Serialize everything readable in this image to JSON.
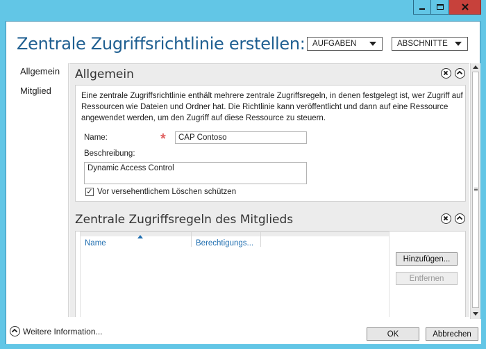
{
  "window": {
    "controls": {
      "minimize_icon": "minimize-icon",
      "maximize_icon": "maximize-icon",
      "close_icon": "close-icon"
    }
  },
  "header": {
    "title": "Zentrale Zugriffsrichtlinie erstellen: CAP...",
    "tasks_label": "AUFGABEN",
    "sections_label": "ABSCHNITTE"
  },
  "nav": {
    "items": [
      {
        "label": "Allgemein"
      },
      {
        "label": "Mitglied"
      }
    ]
  },
  "general": {
    "title": "Allgemein",
    "description": "Eine zentrale Zugriffsrichtlinie enthält mehrere zentrale Zugriffsregeln, in denen festgelegt ist, wer Zugriff auf Ressourcen wie Dateien und Ordner hat. Die Richtlinie kann veröffentlicht und dann auf eine Ressource angewendet werden, um den Zugriff auf diese Ressource zu steuern.",
    "name_label": "Name:",
    "name_value": "CAP Contoso",
    "required_marker": "*",
    "description_label": "Beschreibung:",
    "description_value": "Dynamic Access Control",
    "protect_label": "Vor versehentlichem Löschen schützen",
    "protect_checked": true,
    "check_glyph": "✓"
  },
  "member": {
    "title": "Zentrale Zugriffsregeln des Mitglieds",
    "columns": [
      "Name",
      "Berechtigungs..."
    ],
    "add_label": "Hinzufügen...",
    "remove_label": "Entfernen"
  },
  "footer": {
    "more_info": "Weitere Information...",
    "ok_label": "OK",
    "cancel_label": "Abbrechen"
  },
  "colors": {
    "frame": "#62c6e6",
    "title": "#1f5f91",
    "close": "#c7413b",
    "link": "#1f6eb0"
  }
}
